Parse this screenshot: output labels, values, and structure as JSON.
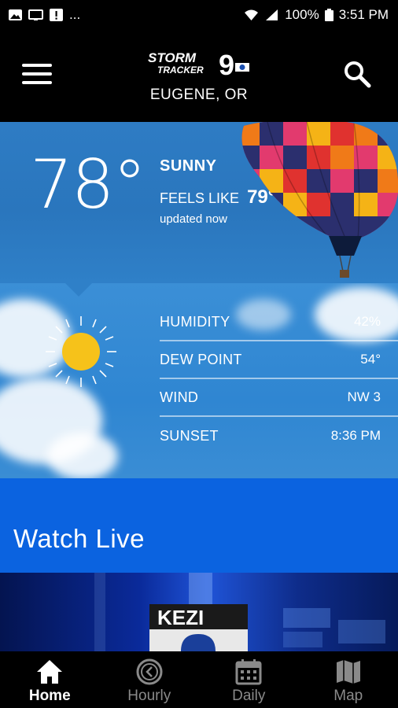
{
  "status_bar": {
    "left_glyphs": "...",
    "battery": "100%",
    "time": "3:51 PM"
  },
  "header": {
    "logo_line1": "STORM",
    "logo_line2": "TRACKER",
    "logo_number": "9",
    "location": "EUGENE, OR"
  },
  "current": {
    "temperature": "78°",
    "condition": "SUNNY",
    "feels_label": "FEELS LIKE",
    "feels_value": "79°",
    "updated": "updated now"
  },
  "details": [
    {
      "label": "HUMIDITY",
      "value": "42%"
    },
    {
      "label": "DEW POINT",
      "value": "54°"
    },
    {
      "label": "WIND",
      "value": "NW 3"
    },
    {
      "label": "SUNSET",
      "value": "8:36 PM"
    }
  ],
  "watch_live": {
    "label": "Watch Live"
  },
  "video": {
    "brand": "KEZI"
  },
  "nav": [
    {
      "label": "Home",
      "icon": "home-icon",
      "active": true
    },
    {
      "label": "Hourly",
      "icon": "clock-icon",
      "active": false
    },
    {
      "label": "Daily",
      "icon": "calendar-icon",
      "active": false
    },
    {
      "label": "Map",
      "icon": "map-icon",
      "active": false
    }
  ],
  "colors": {
    "accent_blue": "#0b63e0",
    "sun_yellow": "#f6c21a"
  }
}
